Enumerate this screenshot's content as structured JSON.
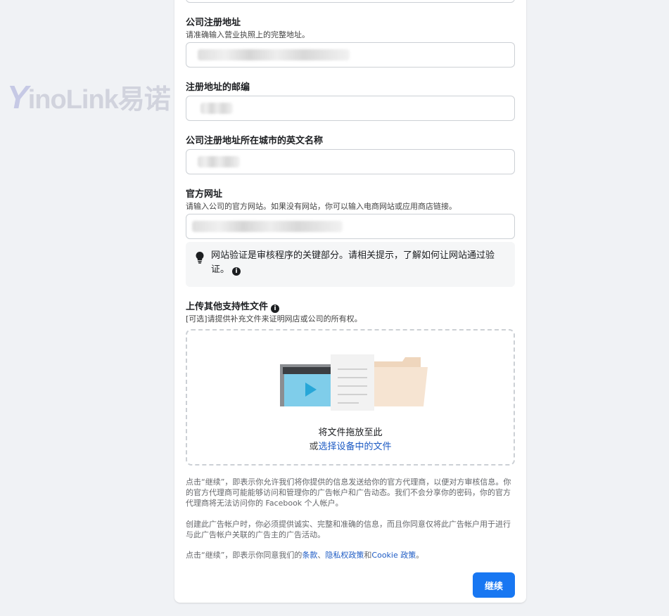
{
  "form": {
    "address_label": "公司注册地址",
    "address_help": "请准确输入营业执照上的完整地址。",
    "postal_label": "注册地址的邮编",
    "city_label": "公司注册地址所在城市的英文名称",
    "website_label": "官方网址",
    "website_help": "请输入公司的官方网站。如果没有网站，你可以输入电商网站或应用商店链接。",
    "website_tip": "网站验证是审核程序的关键部分。请相关提示，了解如何让网站通过验证。",
    "upload_label": "上传其他支持性文件",
    "upload_help": "[可选]请提供补充文件来证明网店或公司的所有权。",
    "drop_main": "将文件拖放至此",
    "drop_or": "或",
    "drop_link": "选择设备中的文件"
  },
  "legal": {
    "p1": "点击“继续”，即表示你允许我们将你提供的信息发送给你的官方代理商，以便对方审核信息。你的官方代理商可能能够访问和管理你的广告帐户和广告动态。我们不会分享你的密码，你的官方代理商将无法访问你的 Facebook 个人帐户。",
    "p2": "创建此广告帐户时，你必须提供诚实、完整和准确的信息，而且你同意仅将此广告帐户用于进行与此广告帐户关联的广告主的广告活动。",
    "p3_prefix": "点击“继续”，即表示你同意我们的",
    "terms": "条款",
    "sep": "、",
    "privacy": "隐私权政策",
    "and": "和",
    "cookie": "Cookie 政策",
    "end": "。"
  },
  "continue_label": "继续",
  "watermark": {
    "y": "Y",
    "rest": "inoLink易诺"
  },
  "colors": {
    "primary": "#1877f2",
    "link": "#1d5bc4",
    "background": "#f0f2f5"
  },
  "icons": {
    "tip": "lightbulb-icon",
    "info": "info-icon",
    "upload": "upload-illustration"
  }
}
